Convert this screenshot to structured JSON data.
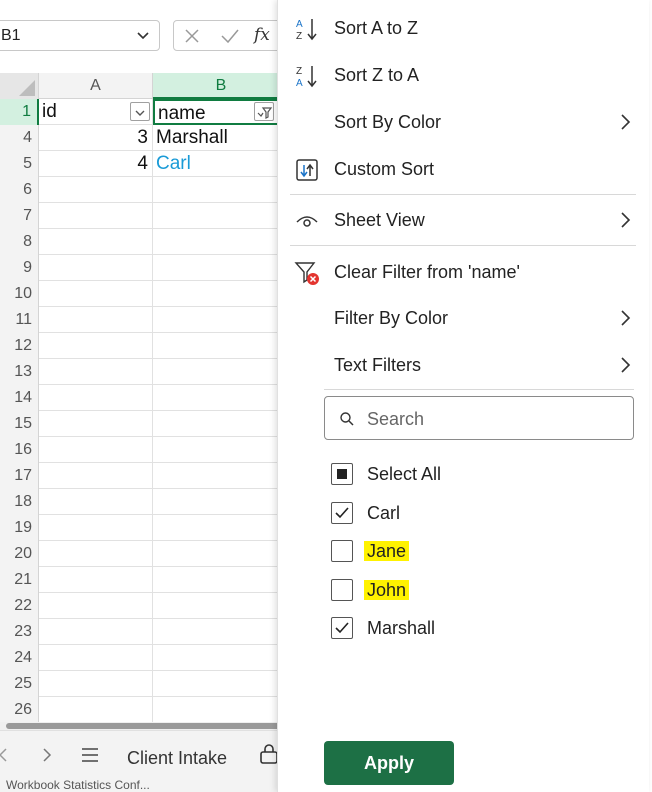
{
  "formula_bar": {
    "name_box": "B1",
    "fx_label": "fx"
  },
  "columns": [
    {
      "label": "A"
    },
    {
      "label": "B"
    }
  ],
  "header_row": {
    "row": "1",
    "a": "id",
    "b": "name"
  },
  "rows": [
    {
      "row": "4",
      "a": "3",
      "b": "Marshall"
    },
    {
      "row": "5",
      "a": "4",
      "b": "Carl"
    },
    {
      "row": "6"
    },
    {
      "row": "7"
    },
    {
      "row": "8"
    },
    {
      "row": "9"
    },
    {
      "row": "10"
    },
    {
      "row": "11"
    },
    {
      "row": "12"
    },
    {
      "row": "13"
    },
    {
      "row": "14"
    },
    {
      "row": "15"
    },
    {
      "row": "16"
    },
    {
      "row": "17"
    },
    {
      "row": "18"
    },
    {
      "row": "19"
    },
    {
      "row": "20"
    },
    {
      "row": "21"
    },
    {
      "row": "22"
    },
    {
      "row": "23"
    },
    {
      "row": "24"
    },
    {
      "row": "25"
    },
    {
      "row": "26"
    }
  ],
  "sheet_tabs": {
    "active": "Client Intake"
  },
  "status_bar": {
    "text": "Workbook Statistics  Conf..."
  },
  "menu": {
    "sort_az": "Sort A to Z",
    "sort_za": "Sort Z to A",
    "sort_by_color": "Sort By Color",
    "custom_sort": "Custom Sort",
    "sheet_view": "Sheet View",
    "clear_filter": "Clear Filter from 'name'",
    "filter_by_color": "Filter By Color",
    "text_filters": "Text Filters",
    "search_placeholder": "Search",
    "items": [
      {
        "label": "Select All",
        "state": "partial",
        "highlight": false
      },
      {
        "label": "Carl",
        "state": "checked",
        "highlight": false
      },
      {
        "label": "Jane",
        "state": "unchecked",
        "highlight": true
      },
      {
        "label": "John",
        "state": "unchecked",
        "highlight": true
      },
      {
        "label": "Marshall",
        "state": "checked",
        "highlight": false
      }
    ],
    "apply_label": "Apply"
  },
  "colors": {
    "accent_green": "#107c41",
    "apply_button": "#1d7045",
    "highlight": "#fff200",
    "link_blue": "#1a9bd7",
    "clear_filter_red": "#e3342f"
  }
}
